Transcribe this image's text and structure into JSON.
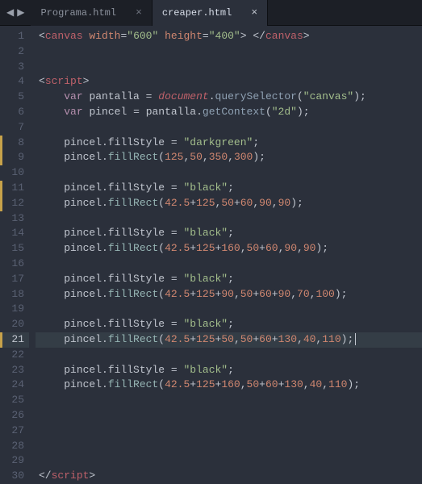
{
  "tabs": [
    {
      "label": "Programa.html",
      "active": false
    },
    {
      "label": "creaper.html",
      "active": true
    }
  ],
  "gutter": {
    "lines": 30,
    "modified": [
      8,
      9,
      11,
      12,
      21
    ],
    "active": 21
  },
  "code": {
    "l1": {
      "t1": "canvas",
      "a1": "width",
      "v1": "\"600\"",
      "a2": "height",
      "v2": "\"400\"",
      "t2": "canvas"
    },
    "l4": {
      "t": "script"
    },
    "l5": {
      "kw": "var",
      "vr": "pantalla",
      "obj": "document",
      "fn": "querySelector",
      "arg": "\"canvas\""
    },
    "l6": {
      "kw": "var",
      "vr": "pincel",
      "obj": "pantalla",
      "fn": "getContext",
      "arg": "\"2d\""
    },
    "l8": {
      "obj": "pincel",
      "prop": "fillStyle",
      "val": "\"darkgreen\""
    },
    "l9": {
      "obj": "pincel",
      "fn": "fillRect",
      "args": "125,50,350,300"
    },
    "l11": {
      "obj": "pincel",
      "prop": "fillStyle",
      "val": "\"black\""
    },
    "l12": {
      "obj": "pincel",
      "fn": "fillRect",
      "args": "42.5+125,50+60,90,90"
    },
    "l14": {
      "obj": "pincel",
      "prop": "fillStyle",
      "val": "\"black\""
    },
    "l15": {
      "obj": "pincel",
      "fn": "fillRect",
      "args": "42.5+125+160,50+60,90,90"
    },
    "l17": {
      "obj": "pincel",
      "prop": "fillStyle",
      "val": "\"black\""
    },
    "l18": {
      "obj": "pincel",
      "fn": "fillRect",
      "args": "42.5+125+90,50+60+90,70,100"
    },
    "l20": {
      "obj": "pincel",
      "prop": "fillStyle",
      "val": "\"black\""
    },
    "l21": {
      "obj": "pincel",
      "fn": "fillRect",
      "args": "42.5+125+50,50+60+130,40,110"
    },
    "l23": {
      "obj": "pincel",
      "prop": "fillStyle",
      "val": "\"black\""
    },
    "l24": {
      "obj": "pincel",
      "fn": "fillRect",
      "args": "42.5+125+160,50+60+130,40,110"
    },
    "l30": {
      "t": "script"
    }
  }
}
